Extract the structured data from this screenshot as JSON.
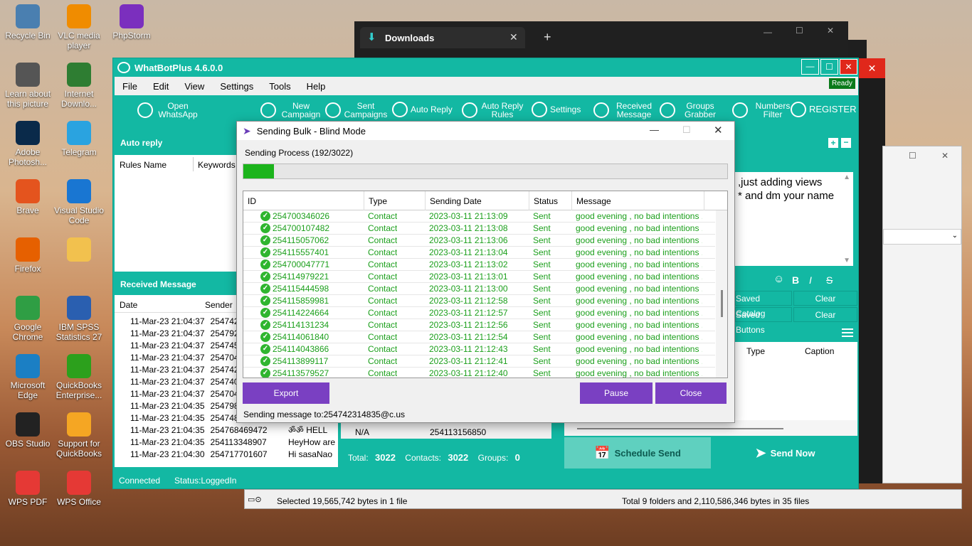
{
  "desktop": {
    "icons": [
      {
        "label": "Recycle Bin",
        "icon": "recycle-bin-icon",
        "color": "#4a7fb0"
      },
      {
        "label": "Learn about this picture",
        "icon": "camera-icon",
        "color": "#555555"
      },
      {
        "label": "Adobe Photosh...",
        "icon": "photoshop-icon",
        "color": "#0a2a4a"
      },
      {
        "label": "Brave",
        "icon": "brave-icon",
        "color": "#e4541e"
      },
      {
        "label": "Firefox",
        "icon": "firefox-icon",
        "color": "#e66000"
      },
      {
        "label": "Google Chrome",
        "icon": "chrome-icon",
        "color": "#2f9e44"
      },
      {
        "label": "Microsoft Edge",
        "icon": "edge-icon",
        "color": "#1b7fc4"
      },
      {
        "label": "OBS Studio",
        "icon": "obs-icon",
        "color": "#222222"
      },
      {
        "label": "WPS PDF",
        "icon": "wps-pdf-icon",
        "color": "#e53935"
      },
      {
        "label": "VLC media player",
        "icon": "vlc-icon",
        "color": "#f08c00"
      },
      {
        "label": "Internet Downlo...",
        "icon": "idm-icon",
        "color": "#2e7d32"
      },
      {
        "label": "Telegram",
        "icon": "telegram-icon",
        "color": "#2aa3e0"
      },
      {
        "label": "Visual Studio Code",
        "icon": "vscode-icon",
        "color": "#1976d2"
      },
      {
        "label": "",
        "icon": "folder-icon",
        "color": "#f2c14e"
      },
      {
        "label": "IBM SPSS Statistics 27",
        "icon": "spss-icon",
        "color": "#2a5fb0"
      },
      {
        "label": "QuickBooks Enterprise...",
        "icon": "quickbooks-icon",
        "color": "#2ca01c"
      },
      {
        "label": "Support for QuickBooks",
        "icon": "lifebuoy-icon",
        "color": "#f5a623"
      },
      {
        "label": "WPS Office",
        "icon": "wps-office-icon",
        "color": "#e53935"
      },
      {
        "label": "PhpStorm",
        "icon": "phpstorm-icon",
        "color": "#7b2fbe"
      }
    ]
  },
  "downloads_window": {
    "tab_label": "Downloads",
    "new_tab": "+"
  },
  "explorer_window": {
    "status_left": "Selected 19,565,742 bytes in 1 file",
    "status_right": "Total 9 folders and 2,110,586,346 bytes in 35 files"
  },
  "whatbot": {
    "title": "WhatBotPlus 4.6.0.0",
    "ready": "Ready",
    "menu": [
      "File",
      "Edit",
      "View",
      "Settings",
      "Tools",
      "Help"
    ],
    "toolbar": [
      {
        "label": "Open WhatsApp",
        "icon": "whatsapp-icon"
      },
      {
        "label": "New Campaign",
        "icon": "megaphone-icon"
      },
      {
        "label": "Sent Campaigns",
        "icon": "sent-campaigns-icon"
      },
      {
        "label": "Auto Reply",
        "icon": "envelope-icon"
      },
      {
        "label": "Auto Reply Rules",
        "icon": "rules-icon"
      },
      {
        "label": "Settings",
        "icon": "gear-icon"
      },
      {
        "label": "Received Message",
        "icon": "inbox-icon"
      },
      {
        "label": "Groups Grabber",
        "icon": "group-icon"
      },
      {
        "label": "Numbers Filter",
        "icon": "filter-icon"
      },
      {
        "label": "REGISTER",
        "icon": "user-icon"
      }
    ],
    "auto_reply": {
      "heading": "Auto reply",
      "col1": "Rules Name",
      "col2": "Keywords"
    },
    "received": {
      "heading": "Received Message",
      "col_date": "Date",
      "col_sender": "Sender",
      "rows": [
        {
          "date": "11-Mar-23 21:04:37",
          "sender": "25474270",
          "msg": ""
        },
        {
          "date": "11-Mar-23 21:04:37",
          "sender": "25479277",
          "msg": ""
        },
        {
          "date": "11-Mar-23 21:04:37",
          "sender": "25474554",
          "msg": ""
        },
        {
          "date": "11-Mar-23 21:04:37",
          "sender": "25470431",
          "msg": ""
        },
        {
          "date": "11-Mar-23 21:04:37",
          "sender": "25474209",
          "msg": ""
        },
        {
          "date": "11-Mar-23 21:04:37",
          "sender": "25474032",
          "msg": ""
        },
        {
          "date": "11-Mar-23 21:04:37",
          "sender": "25470487",
          "msg": ""
        },
        {
          "date": "11-Mar-23 21:04:35",
          "sender": "25479882",
          "msg": ""
        },
        {
          "date": "11-Mar-23 21:04:35",
          "sender": "25474844",
          "msg": ""
        },
        {
          "date": "11-Mar-23 21:04:35",
          "sender": "254768469472",
          "msg": "ॐॐ HELL"
        },
        {
          "date": "11-Mar-23 21:04:35",
          "sender": "254113348907",
          "msg": "HeyHow are"
        },
        {
          "date": "11-Mar-23 21:04:30",
          "sender": "254717701607",
          "msg": "Hi sasaNao"
        }
      ]
    },
    "message_preview": [
      ",just adding views",
      "* and dm your name"
    ],
    "format_buttons": [
      "☺",
      "B",
      "I",
      "S"
    ],
    "saved": [
      {
        "label": "Saved Catalog",
        "clear": "Clear"
      },
      {
        "label": "Saved Buttons",
        "clear": "Clear"
      }
    ],
    "attach_cols": {
      "type": "Type",
      "caption": "Caption"
    },
    "bottom_row": {
      "col1": "N/A",
      "col2": "254113156850"
    },
    "totals": {
      "total_label": "Total:",
      "total": "3022",
      "contacts_label": "Contacts:",
      "contacts": "3022",
      "groups_label": "Groups:",
      "groups": "0"
    },
    "schedule_send": "Schedule Send",
    "send_now": "Send Now",
    "status": {
      "connected": "Connected",
      "logged": "Status:LoggedIn"
    }
  },
  "dialog": {
    "title": "Sending Bulk - Blind Mode",
    "process": "Sending Process (192/3022)",
    "progress_fraction": 0.0635,
    "columns": {
      "id": "ID",
      "type": "Type",
      "date": "Sending Date",
      "status": "Status",
      "message": "Message"
    },
    "rows": [
      {
        "id": "254700346026",
        "type": "Contact",
        "date": "2023-03-11 21:13:09",
        "status": "Sent",
        "message": "good evening , no bad intentions ,j..."
      },
      {
        "id": "254700107482",
        "type": "Contact",
        "date": "2023-03-11 21:13:08",
        "status": "Sent",
        "message": "good evening , no bad intentions ,j..."
      },
      {
        "id": "254115057062",
        "type": "Contact",
        "date": "2023-03-11 21:13:06",
        "status": "Sent",
        "message": "good evening , no bad intentions ,j..."
      },
      {
        "id": "254115557401",
        "type": "Contact",
        "date": "2023-03-11 21:13:04",
        "status": "Sent",
        "message": "good evening , no bad intentions ,j..."
      },
      {
        "id": "254700047771",
        "type": "Contact",
        "date": "2023-03-11 21:13:02",
        "status": "Sent",
        "message": "good evening , no bad intentions ,j..."
      },
      {
        "id": "254114979221",
        "type": "Contact",
        "date": "2023-03-11 21:13:01",
        "status": "Sent",
        "message": "good evening , no bad intentions ,j..."
      },
      {
        "id": "254115444598",
        "type": "Contact",
        "date": "2023-03-11 21:13:00",
        "status": "Sent",
        "message": "good evening , no bad intentions ,j..."
      },
      {
        "id": "254115859981",
        "type": "Contact",
        "date": "2023-03-11 21:12:58",
        "status": "Sent",
        "message": "good evening , no bad intentions ,j..."
      },
      {
        "id": "254114224664",
        "type": "Contact",
        "date": "2023-03-11 21:12:57",
        "status": "Sent",
        "message": "good evening , no bad intentions ,j..."
      },
      {
        "id": "254114131234",
        "type": "Contact",
        "date": "2023-03-11 21:12:56",
        "status": "Sent",
        "message": "good evening , no bad intentions ,j..."
      },
      {
        "id": "254114061840",
        "type": "Contact",
        "date": "2023-03-11 21:12:54",
        "status": "Sent",
        "message": "good evening , no bad intentions ,j..."
      },
      {
        "id": "254114043866",
        "type": "Contact",
        "date": "2023-03-11 21:12:43",
        "status": "Sent",
        "message": "good evening , no bad intentions ,j..."
      },
      {
        "id": "254113899117",
        "type": "Contact",
        "date": "2023-03-11 21:12:41",
        "status": "Sent",
        "message": "good evening , no bad intentions ,j..."
      },
      {
        "id": "254113579527",
        "type": "Contact",
        "date": "2023-03-11 21:12:40",
        "status": "Sent",
        "message": "good evening , no bad intentions ,j..."
      }
    ],
    "export": "Export",
    "pause": "Pause",
    "close": "Close",
    "sending_to": "Sending message to:254742314835@c.us"
  },
  "colors": {
    "teal": "#13b8a3",
    "purple": "#7a40c2",
    "sent_green": "#1b9f1b",
    "progress": "#1cb41c"
  }
}
